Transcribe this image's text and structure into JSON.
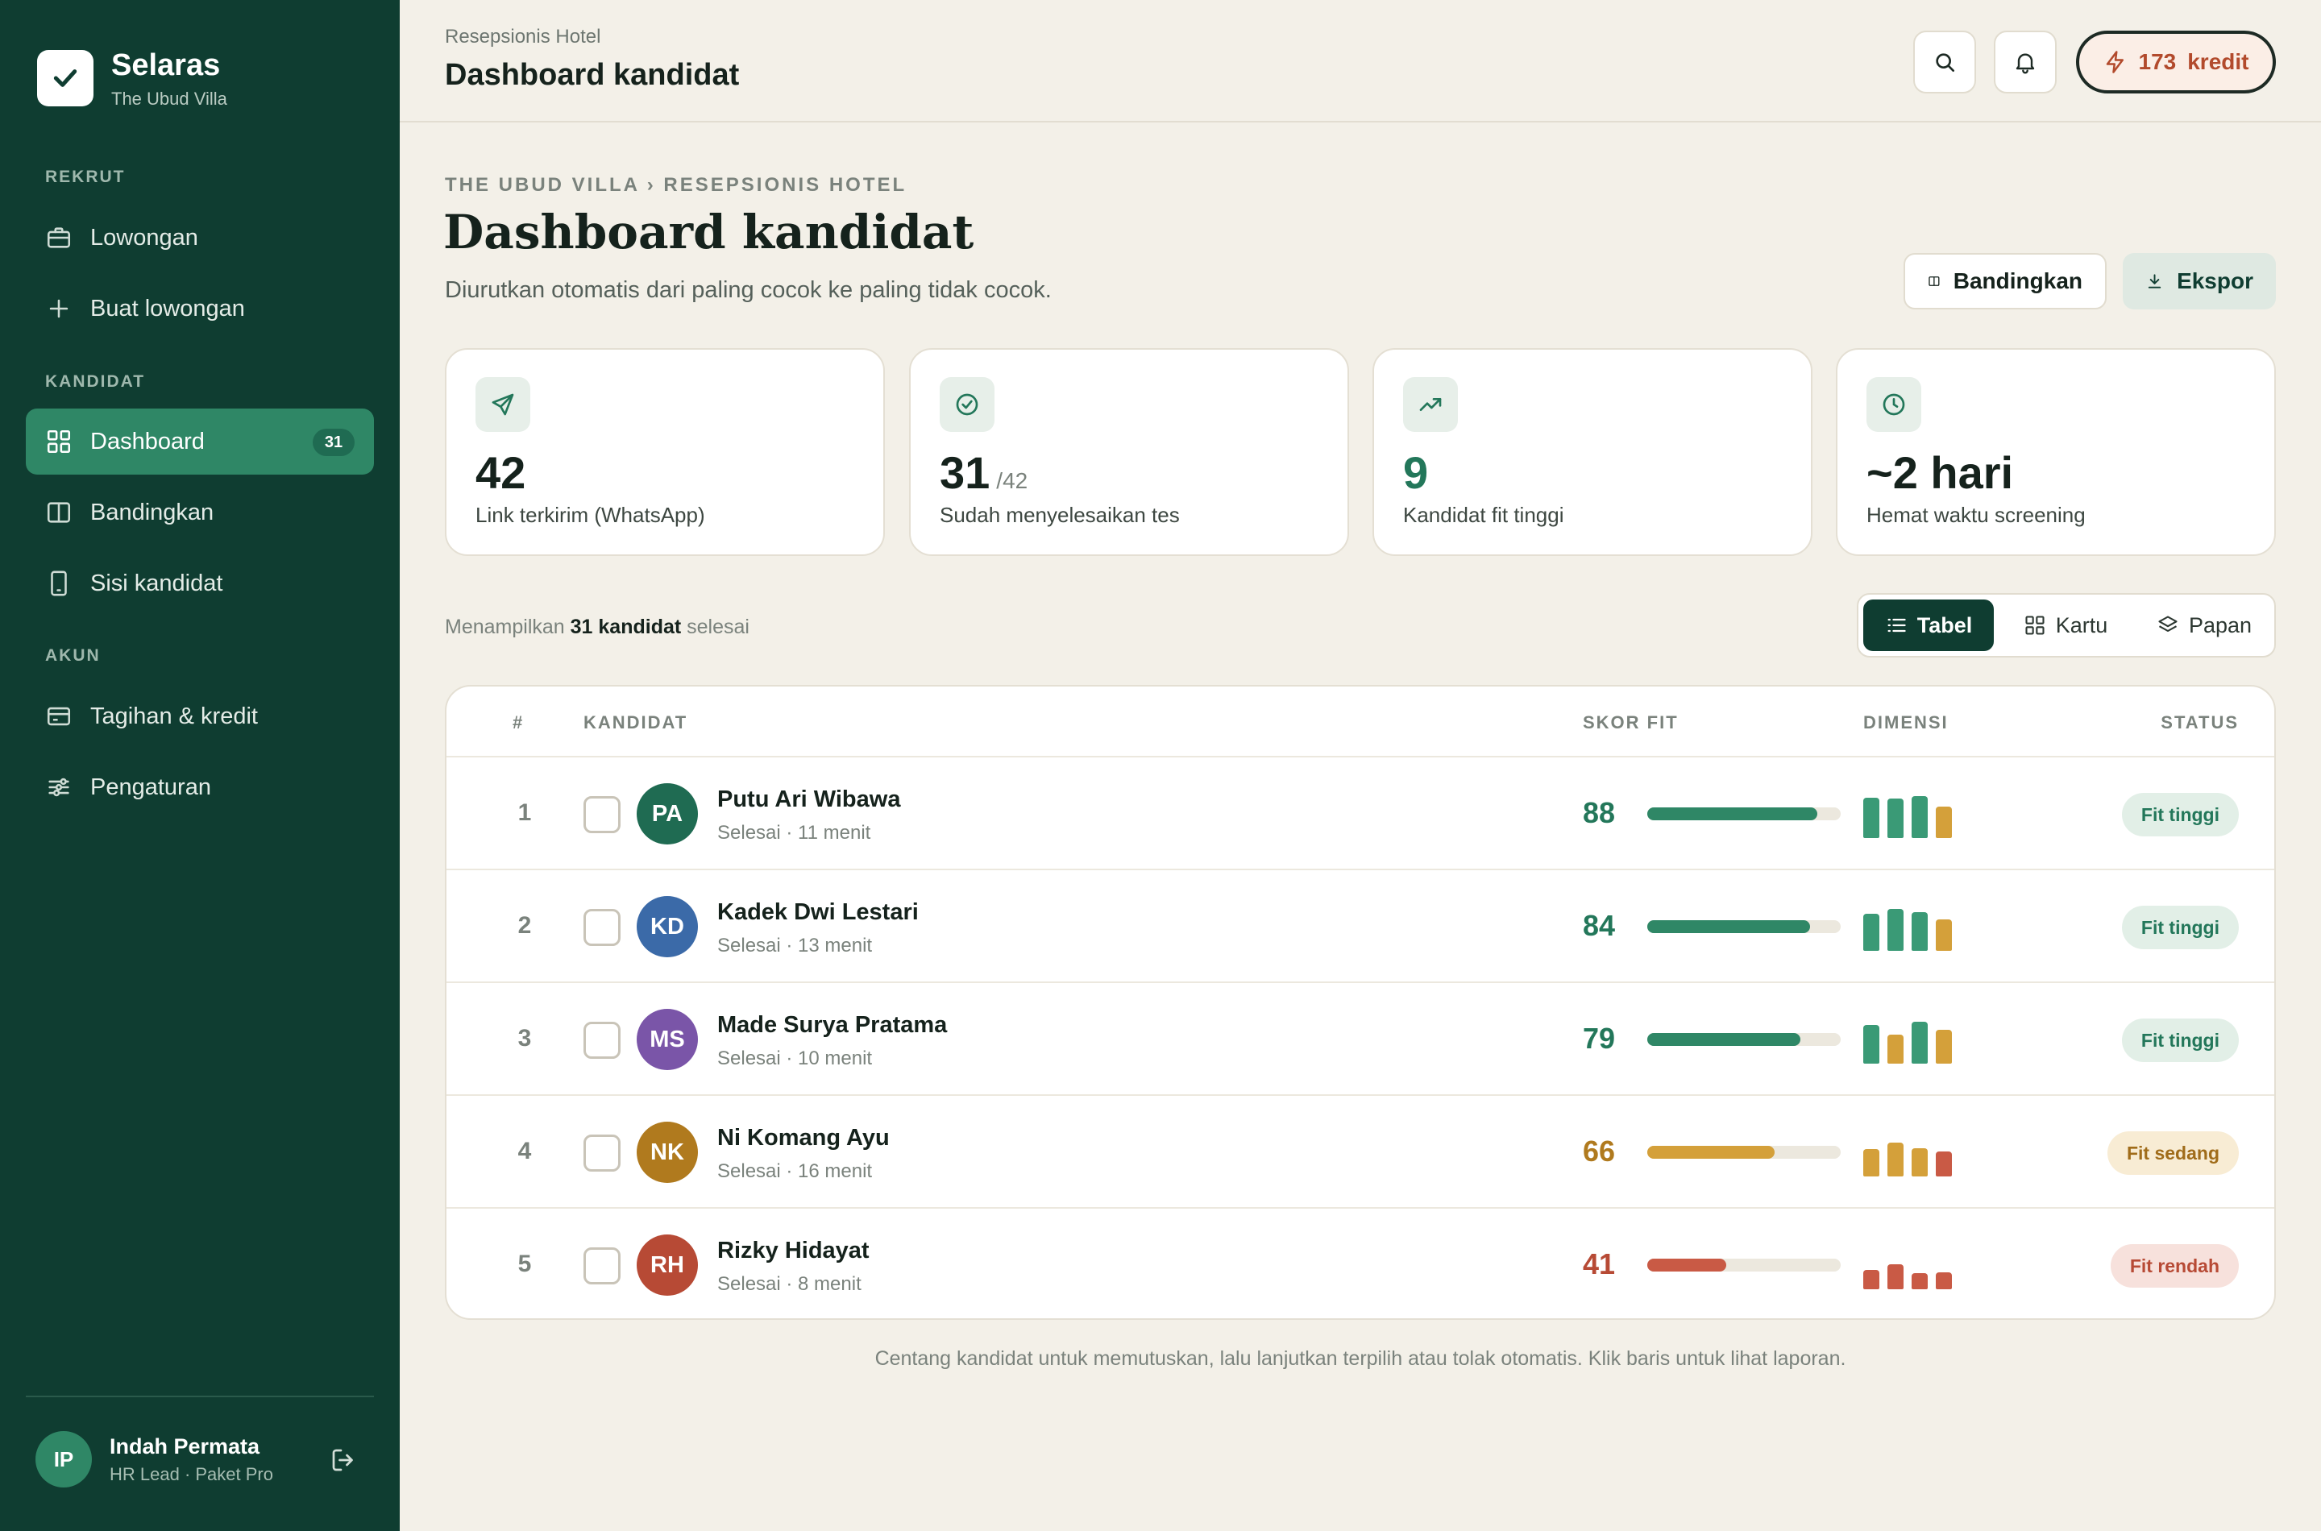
{
  "brand": {
    "name": "Selaras",
    "sub": "The Ubud Villa"
  },
  "sidebar": {
    "sections": {
      "rekrut": "REKRUT",
      "kandidat": "KANDIDAT",
      "akun": "AKUN"
    },
    "items": [
      {
        "label": "Lowongan",
        "icon": "briefcase-icon"
      },
      {
        "label": "Buat lowongan",
        "icon": "plus-icon"
      },
      {
        "label": "Dashboard",
        "icon": "grid-icon",
        "badge": "31",
        "active": true
      },
      {
        "label": "Bandingkan",
        "icon": "columns-icon"
      },
      {
        "label": "Sisi kandidat",
        "icon": "phone-icon"
      },
      {
        "label": "Tagihan & kredit",
        "icon": "card-icon"
      },
      {
        "label": "Pengaturan",
        "icon": "sliders-icon"
      }
    ]
  },
  "user": {
    "initials": "IP",
    "name": "Indah Permata",
    "role": "HR Lead · Paket Pro"
  },
  "topbar": {
    "subtitle": "Resepsionis Hotel",
    "title": "Dashboard kandidat",
    "credits": "173",
    "credits_label": "kredit"
  },
  "page": {
    "breadcrumb": "THE UBUD VILLA › RESEPSIONIS HOTEL",
    "title": "Dashboard kandidat",
    "description": "Diurutkan otomatis dari paling cocok ke paling tidak cocok.",
    "compare_label": "Bandingkan",
    "export_label": "Ekspor"
  },
  "stats": [
    {
      "value": "42",
      "of": "",
      "label": "Link terkirim (WhatsApp)",
      "icon": "send-icon"
    },
    {
      "value": "31",
      "of": "/42",
      "label": "Sudah menyelesaikan tes",
      "icon": "check-circle-icon"
    },
    {
      "value": "9",
      "of": "",
      "label": "Kandidat fit tinggi",
      "icon": "trending-up-icon"
    },
    {
      "value": "~2 hari",
      "of": "",
      "label": "Hemat waktu screening",
      "icon": "clock-icon"
    }
  ],
  "list": {
    "showing_prefix": "Menampilkan",
    "showing_count": "31 kandidat",
    "showing_suffix": "selesai",
    "views": [
      "Tabel",
      "Kartu",
      "Papan"
    ]
  },
  "table": {
    "headers": {
      "rank": "#",
      "candidate": "KANDIDAT",
      "score": "SKOR FIT",
      "dims": "DIMENSI",
      "status": "STATUS"
    },
    "rows": [
      {
        "rank": "1",
        "initials": "PA",
        "name": "Putu Ari Wibawa",
        "sub": "Selesai · 11 menit",
        "score": 88,
        "status": "Fit tinggi",
        "level": "high",
        "avatar_color": "#1f6b52",
        "dims": [
          0.9,
          0.88,
          0.92,
          0.7
        ],
        "dim_colors": [
          "#3a9a76",
          "#3a9a76",
          "#3a9a76",
          "#d4a03a"
        ]
      },
      {
        "rank": "2",
        "initials": "KD",
        "name": "Kadek Dwi Lestari",
        "sub": "Selesai · 13 menit",
        "score": 84,
        "status": "Fit tinggi",
        "level": "high",
        "avatar_color": "#3b6aa8",
        "dims": [
          0.82,
          0.92,
          0.85,
          0.7
        ],
        "dim_colors": [
          "#3a9a76",
          "#3a9a76",
          "#3a9a76",
          "#d4a03a"
        ]
      },
      {
        "rank": "3",
        "initials": "MS",
        "name": "Made Surya Pratama",
        "sub": "Selesai · 10 menit",
        "score": 79,
        "status": "Fit tinggi",
        "level": "high",
        "avatar_color": "#7a55a8",
        "dims": [
          0.85,
          0.65,
          0.92,
          0.75
        ],
        "dim_colors": [
          "#3a9a76",
          "#d4a03a",
          "#3a9a76",
          "#d4a03a"
        ]
      },
      {
        "rank": "4",
        "initials": "NK",
        "name": "Ni Komang Ayu",
        "sub": "Selesai · 16 menit",
        "score": 66,
        "status": "Fit sedang",
        "level": "mid",
        "avatar_color": "#b07a1e",
        "dims": [
          0.6,
          0.75,
          0.62,
          0.55
        ],
        "dim_colors": [
          "#d4a03a",
          "#d4a03a",
          "#d4a03a",
          "#c95a45"
        ]
      },
      {
        "rank": "5",
        "initials": "RH",
        "name": "Rizky Hidayat",
        "sub": "Selesai · 8 menit",
        "score": 41,
        "status": "Fit rendah",
        "level": "low",
        "avatar_color": "#b74a35",
        "dims": [
          0.42,
          0.55,
          0.35,
          0.38
        ],
        "dim_colors": [
          "#c95a45",
          "#c95a45",
          "#c95a45",
          "#c95a45"
        ]
      }
    ]
  },
  "level_colors": {
    "high": {
      "text": "#23775a",
      "bar": "#2f8766",
      "badge_bg": "#e2efe7",
      "badge_text": "#23775a"
    },
    "mid": {
      "text": "#b07a1e",
      "bar": "#d4a03a",
      "badge_bg": "#f8ecd4",
      "badge_text": "#a06c1a"
    },
    "low": {
      "text": "#b74a35",
      "bar": "#c95a45",
      "badge_bg": "#f7e1dc",
      "badge_text": "#b74a35"
    }
  },
  "footnote": "Centang kandidat untuk memutuskan, lalu lanjutkan terpilih atau tolak otomatis. Klik baris untuk lihat laporan."
}
